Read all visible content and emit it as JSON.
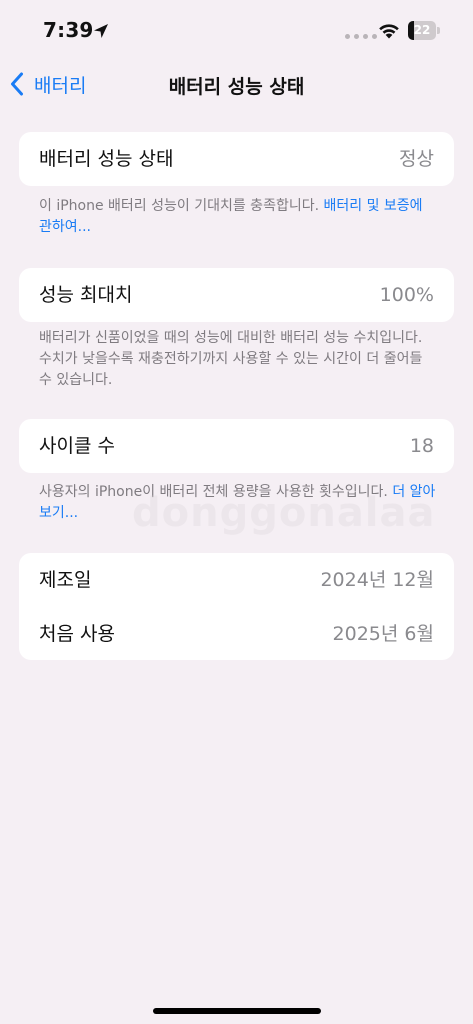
{
  "status_bar": {
    "time": "7:39",
    "battery_level": "22",
    "battery_fraction": 0.22
  },
  "nav": {
    "back_label": "배터리",
    "title": "배터리 성능 상태"
  },
  "sections": {
    "health": {
      "label": "배터리 성능 상태",
      "value": "정상",
      "footnote_text": "이 iPhone 배터리 성능이 기대치를 충족합니다. ",
      "footnote_link": "배터리 및 보증에 관하여..."
    },
    "max_capacity": {
      "label": "성능 최대치",
      "value": "100%",
      "footnote_text": "배터리가 신품이었을 때의 성능에 대비한 배터리 성능 수치입니다. 수치가 낮을수록 재충전하기까지 사용할 수 있는 시간이 더 줄어들 수 있습니다."
    },
    "cycle_count": {
      "label": "사이클 수",
      "value": "18",
      "footnote_text": "사용자의 iPhone이 배터리 전체 용량을 사용한 횟수입니다. ",
      "footnote_link": "더 알아보기..."
    },
    "dates": {
      "manufacture_label": "제조일",
      "manufacture_value": "2024년 12월",
      "first_use_label": "처음 사용",
      "first_use_value": "2025년 6월"
    }
  },
  "watermark": "donggonalaa",
  "colors": {
    "accent": "#1a7cf5",
    "background": "#f5eff4",
    "secondary_text": "#8a8a8e"
  }
}
